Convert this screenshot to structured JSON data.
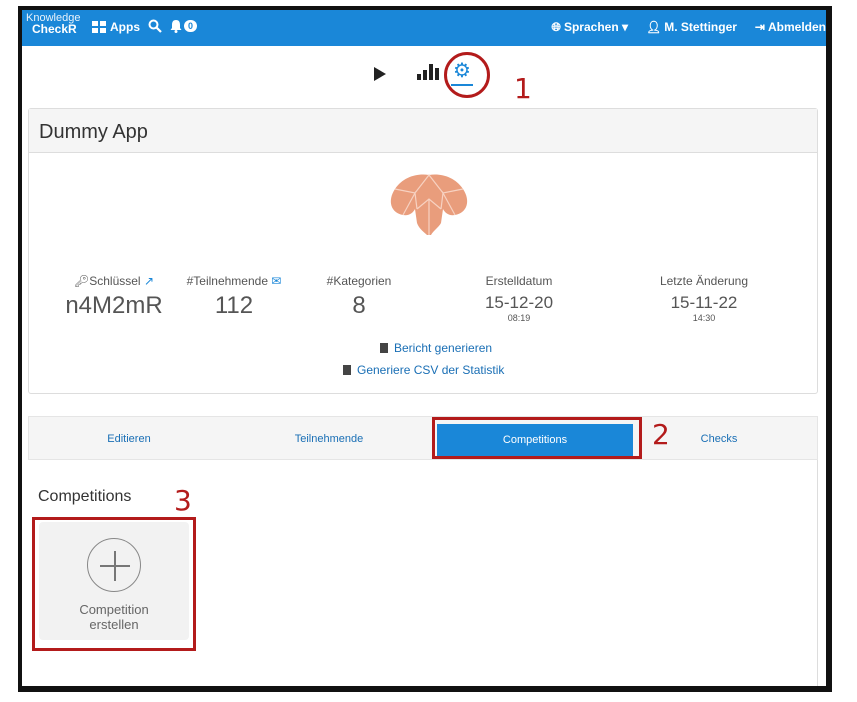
{
  "navbar": {
    "brand_line1": "Knowledge",
    "brand_line2": "CheckR",
    "apps_label": "Apps",
    "notification_count": "0",
    "language_label": "Sprachen",
    "user_label": "M. Stettinger",
    "logout_label": "Abmelden"
  },
  "toolbar": {
    "icons": [
      "play-icon",
      "stats-icon",
      "gear-icon"
    ],
    "active": "gear-icon"
  },
  "annotations": {
    "one": "1",
    "two": "2",
    "three": "3"
  },
  "app": {
    "title": "Dummy App",
    "stats": {
      "key_label": "Schlüssel",
      "key_value": "n4M2mR",
      "participants_label": "#Teilnehmende",
      "participants_value": "112",
      "categories_label": "#Kategorien",
      "categories_value": "8",
      "created_label": "Erstelldatum",
      "created_date": "15-12-20",
      "created_time": "08:19",
      "changed_label": "Letzte Änderung",
      "changed_date": "15-11-22",
      "changed_time": "14:30"
    },
    "report_link": "Bericht generieren",
    "csv_link": "Generiere CSV der Statistik"
  },
  "tabs": [
    {
      "label": "Editieren"
    },
    {
      "label": "Teilnehmende"
    },
    {
      "label": "Competitions"
    },
    {
      "label": "Checks"
    }
  ],
  "competitions": {
    "title": "Competitions",
    "create_line1": "Competition",
    "create_line2": "erstellen"
  },
  "colors": {
    "primary": "#1a87d8",
    "annotation": "#b31b1b"
  }
}
